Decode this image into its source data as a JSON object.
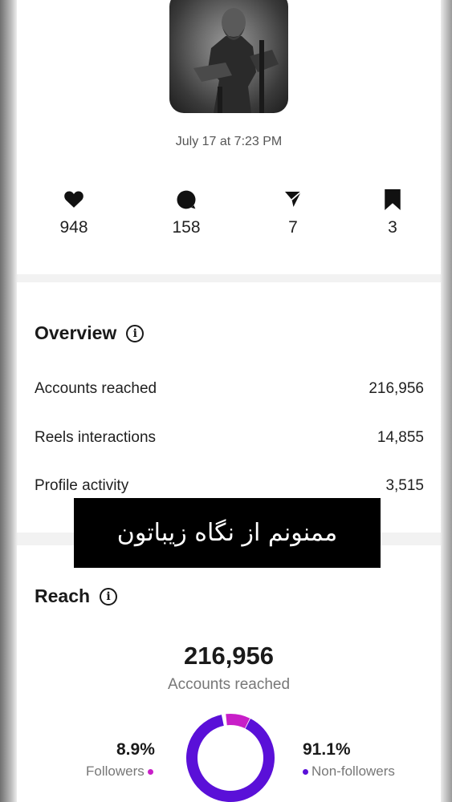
{
  "post": {
    "timestamp": "July 17 at 7:23 PM",
    "stats": [
      {
        "icon": "heart-icon",
        "value": "948"
      },
      {
        "icon": "comment-icon",
        "value": "158"
      },
      {
        "icon": "share-icon",
        "value": "7"
      },
      {
        "icon": "bookmark-icon",
        "value": "3"
      }
    ]
  },
  "overview": {
    "title": "Overview",
    "rows": [
      {
        "label": "Accounts reached",
        "value": "216,956"
      },
      {
        "label": "Reels interactions",
        "value": "14,855"
      },
      {
        "label": "Profile activity",
        "value": "3,515"
      }
    ]
  },
  "overlay_text": "ممنونم از نگاه زیباتون",
  "reach": {
    "title": "Reach",
    "total": "216,956",
    "total_label": "Accounts reached",
    "followers_pct": "8.9%",
    "followers_label": "Followers",
    "nonfollowers_pct": "91.1%",
    "nonfollowers_label": "Non-followers",
    "followers_fraction": 0.089,
    "colors": {
      "followers": "#c81ec8",
      "nonfollowers": "#5a10d8"
    }
  }
}
